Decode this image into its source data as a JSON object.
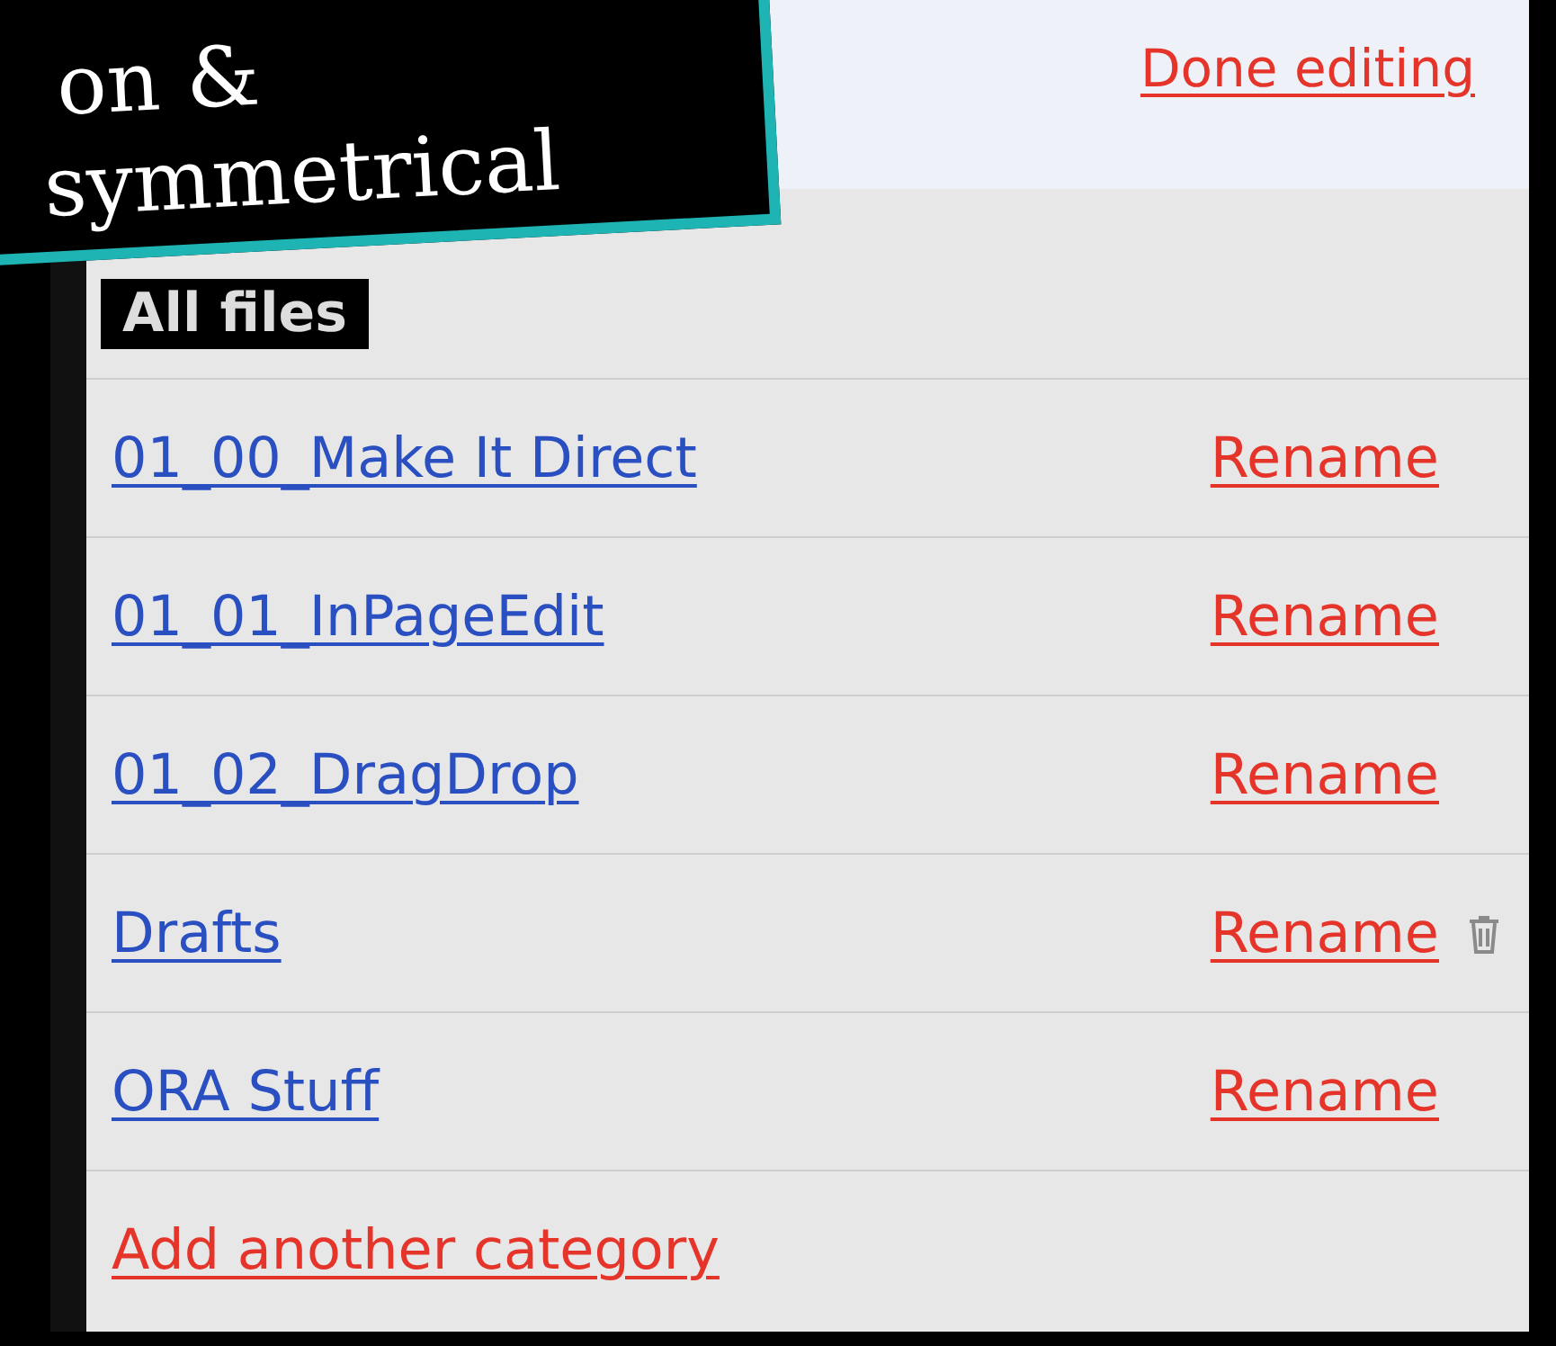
{
  "callout": {
    "lines": [
      "on &",
      "symmetrical"
    ]
  },
  "header": {
    "done_link": "Done editing"
  },
  "section_label": "All files",
  "categories": [
    {
      "name": "01_00_Make It Direct",
      "rename": "Rename",
      "deletable": false
    },
    {
      "name": "01_01_InPageEdit",
      "rename": "Rename",
      "deletable": false
    },
    {
      "name": "01_02_DragDrop",
      "rename": "Rename",
      "deletable": false
    },
    {
      "name": "Drafts",
      "rename": "Rename",
      "deletable": true
    },
    {
      "name": "ORA Stuff",
      "rename": "Rename",
      "deletable": false
    }
  ],
  "add_link": "Add another category"
}
